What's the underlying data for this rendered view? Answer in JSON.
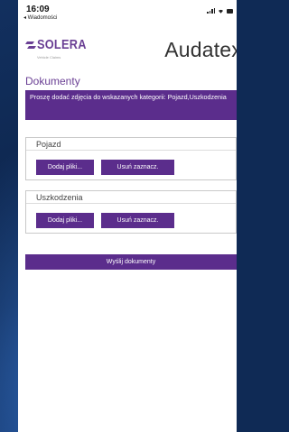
{
  "status_bar": {
    "time": "16:09",
    "back_label": "◂ Wiadomości",
    "icons": [
      "signal-icon",
      "wifi-icon",
      "battery-icon"
    ]
  },
  "header": {
    "logo_text": "SOLERA",
    "logo_tagline": "Vehicle Claims",
    "brand": "Audatex"
  },
  "page": {
    "title": "Dokumenty",
    "banner_text": "Proszę dodać zdjęcia do wskazanych kategorii: Pojazd,Uszkodzenia"
  },
  "sections": [
    {
      "title": "Pojazd",
      "add_label": "Dodaj pliki...",
      "clear_label": "Usuń zaznacz."
    },
    {
      "title": "Uszkodzenia",
      "add_label": "Dodaj pliki...",
      "clear_label": "Usuń zaznacz."
    }
  ],
  "send_label": "Wyślij dokumenty",
  "colors": {
    "accent": "#5b2d8c",
    "title": "#6a3f94",
    "background": "#0f2a55"
  }
}
